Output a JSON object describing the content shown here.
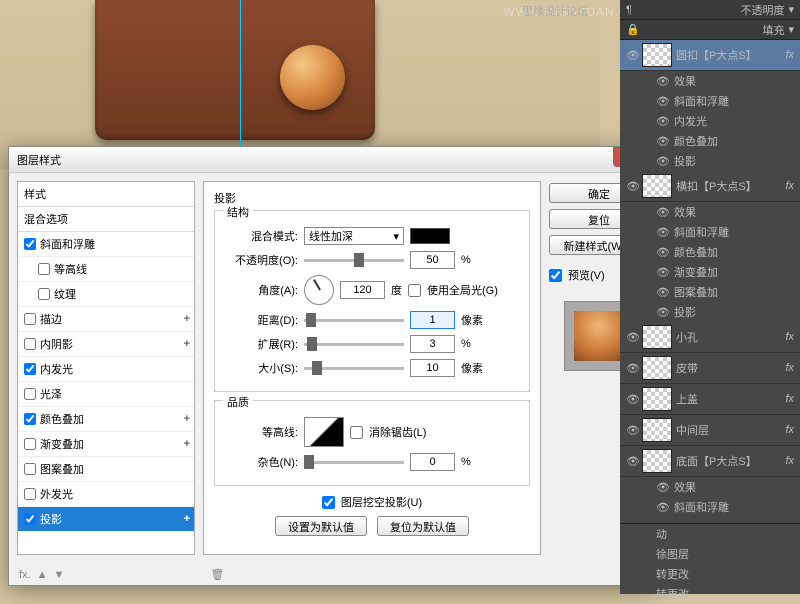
{
  "watermark": "WWW.MISSYUAN.COM",
  "forum_name": "思缘设计论坛",
  "dialog": {
    "title": "图层样式",
    "styles_header": "样式",
    "blend_header": "混合选项",
    "items": [
      {
        "label": "斜面和浮雕",
        "checked": true,
        "plus": false
      },
      {
        "label": "等高线",
        "checked": false,
        "plus": false,
        "indent": true
      },
      {
        "label": "纹理",
        "checked": false,
        "plus": false,
        "indent": true
      },
      {
        "label": "描边",
        "checked": false,
        "plus": true
      },
      {
        "label": "内阴影",
        "checked": false,
        "plus": true
      },
      {
        "label": "内发光",
        "checked": true,
        "plus": false
      },
      {
        "label": "光泽",
        "checked": false,
        "plus": false
      },
      {
        "label": "颜色叠加",
        "checked": true,
        "plus": true
      },
      {
        "label": "渐变叠加",
        "checked": false,
        "plus": true
      },
      {
        "label": "图案叠加",
        "checked": false,
        "plus": false
      },
      {
        "label": "外发光",
        "checked": false,
        "plus": false
      },
      {
        "label": "投影",
        "checked": true,
        "plus": true,
        "selected": true
      }
    ],
    "section": {
      "title": "投影",
      "structure_label": "结构",
      "blend_mode_label": "混合模式:",
      "blend_mode_value": "线性加深",
      "opacity_label": "不透明度(O):",
      "opacity_value": "50",
      "angle_label": "角度(A):",
      "angle_value": "120",
      "angle_unit": "度",
      "global_light": "使用全局光(G)",
      "distance_label": "距离(D):",
      "distance_value": "1",
      "distance_unit": "像素",
      "spread_label": "扩展(R):",
      "spread_value": "3",
      "size_label": "大小(S):",
      "size_value": "10",
      "size_unit": "像素",
      "quality_label": "品质",
      "contour_label": "等高线:",
      "antialias": "消除锯齿(L)",
      "noise_label": "杂色(N):",
      "noise_value": "0",
      "knockout": "图层挖空投影(U)",
      "make_default": "设置为默认值",
      "reset_default": "复位为默认值",
      "percent": "%"
    },
    "buttons": {
      "ok": "确定",
      "cancel": "复位",
      "new_style": "新建样式(W)...",
      "preview": "预览(V)"
    }
  },
  "panel": {
    "top_label": "不透明度",
    "fill_label": "填充",
    "layers": [
      {
        "name": "圆扣【P大点S】",
        "sel": true,
        "fx": [
          "效果",
          "斜面和浮雕",
          "内发光",
          "颜色叠加",
          "投影"
        ]
      },
      {
        "name": "横扣【P大点S】",
        "fx": [
          "效果",
          "斜面和浮雕",
          "颜色叠加",
          "渐变叠加",
          "图案叠加",
          "投影"
        ]
      },
      {
        "name": "小孔"
      },
      {
        "name": "皮带"
      },
      {
        "name": "上盖"
      },
      {
        "name": "中间层"
      },
      {
        "name": "底面【P大点S】",
        "fx": [
          "效果",
          "斜面和浮雕"
        ]
      }
    ],
    "history": [
      "动",
      "徐图层",
      "转更改",
      "转更改"
    ]
  }
}
